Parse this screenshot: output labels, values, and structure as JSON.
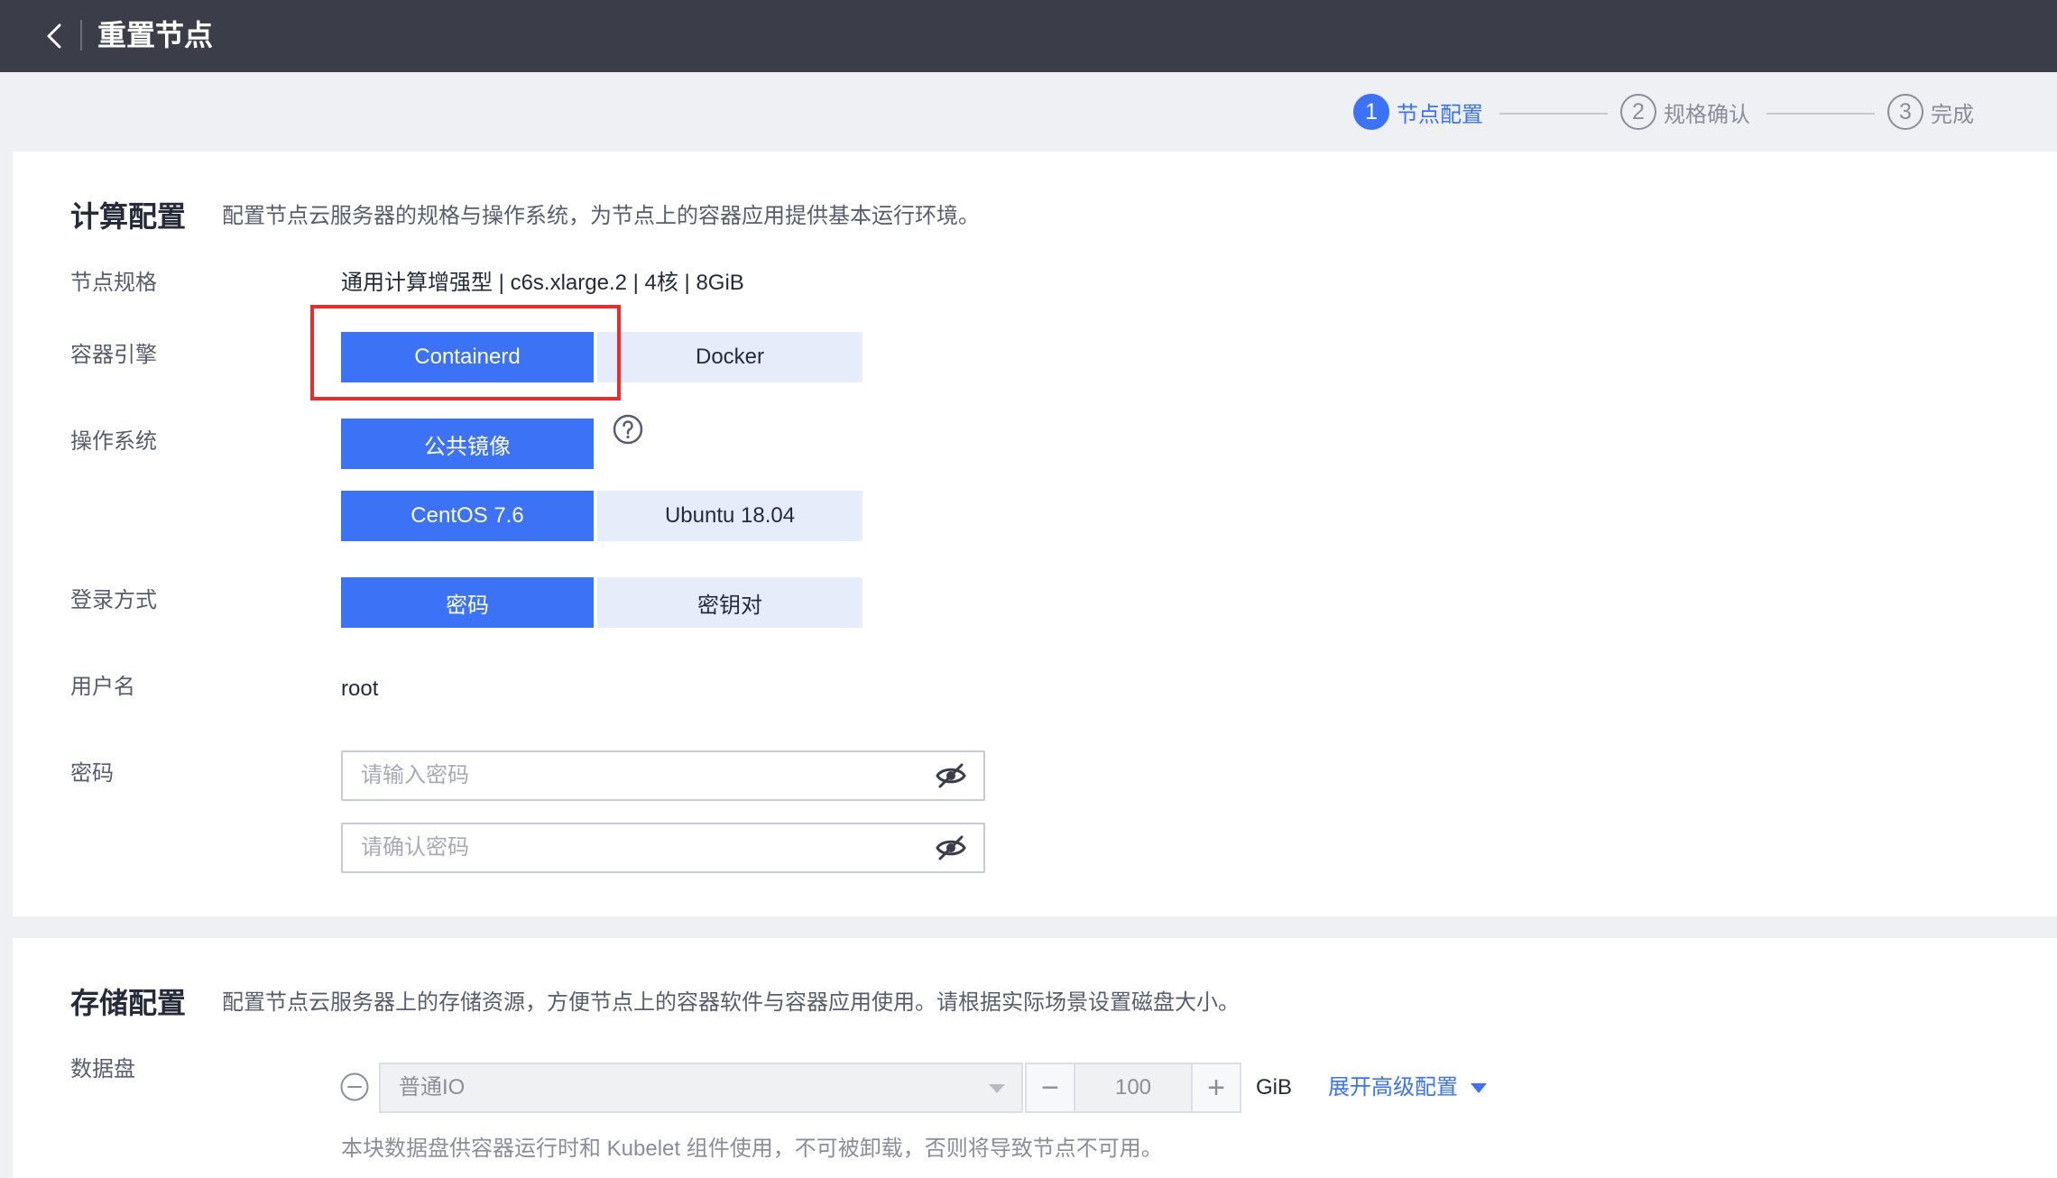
{
  "header": {
    "title": "重置节点",
    "back_icon": "chevron-left-icon"
  },
  "steps": [
    {
      "num": "1",
      "label": "节点配置",
      "active": true
    },
    {
      "num": "2",
      "label": "规格确认",
      "active": false
    },
    {
      "num": "3",
      "label": "完成",
      "active": false
    }
  ],
  "compute": {
    "title": "计算配置",
    "desc": "配置节点云服务器的规格与操作系统，为节点上的容器应用提供基本运行环境。",
    "spec_label": "节点规格",
    "spec_value": "通用计算增强型 | c6s.xlarge.2 | 4核 | 8GiB",
    "engine_label": "容器引擎",
    "engine_options": [
      "Containerd",
      "Docker"
    ],
    "engine_selected": "Containerd",
    "os_label": "操作系统",
    "image_type": "公共镜像",
    "os_options": [
      "CentOS 7.6",
      "Ubuntu 18.04"
    ],
    "os_selected": "CentOS 7.6",
    "login_label": "登录方式",
    "login_options": [
      "密码",
      "密钥对"
    ],
    "login_selected": "密码",
    "user_label": "用户名",
    "user_value": "root",
    "pwd_label": "密码",
    "pwd_placeholder": "请输入密码",
    "pwd_confirm_placeholder": "请确认密码"
  },
  "storage": {
    "title": "存储配置",
    "desc": "配置节点云服务器上的存储资源，方便节点上的容器软件与容器应用使用。请根据实际场景设置磁盘大小。",
    "disk_label": "数据盘",
    "disk_type": "普通IO",
    "disk_size": "100",
    "unit": "GiB",
    "advanced_link": "展开高级配置",
    "note": "本块数据盘供容器运行时和 Kubelet 组件使用，不可被卸载，否则将导致节点不可用。"
  },
  "colors": {
    "primary": "#3b72f6",
    "topbar": "#3b3e48",
    "highlight": "#e62e2e",
    "segment_off": "#e6ecfa"
  }
}
